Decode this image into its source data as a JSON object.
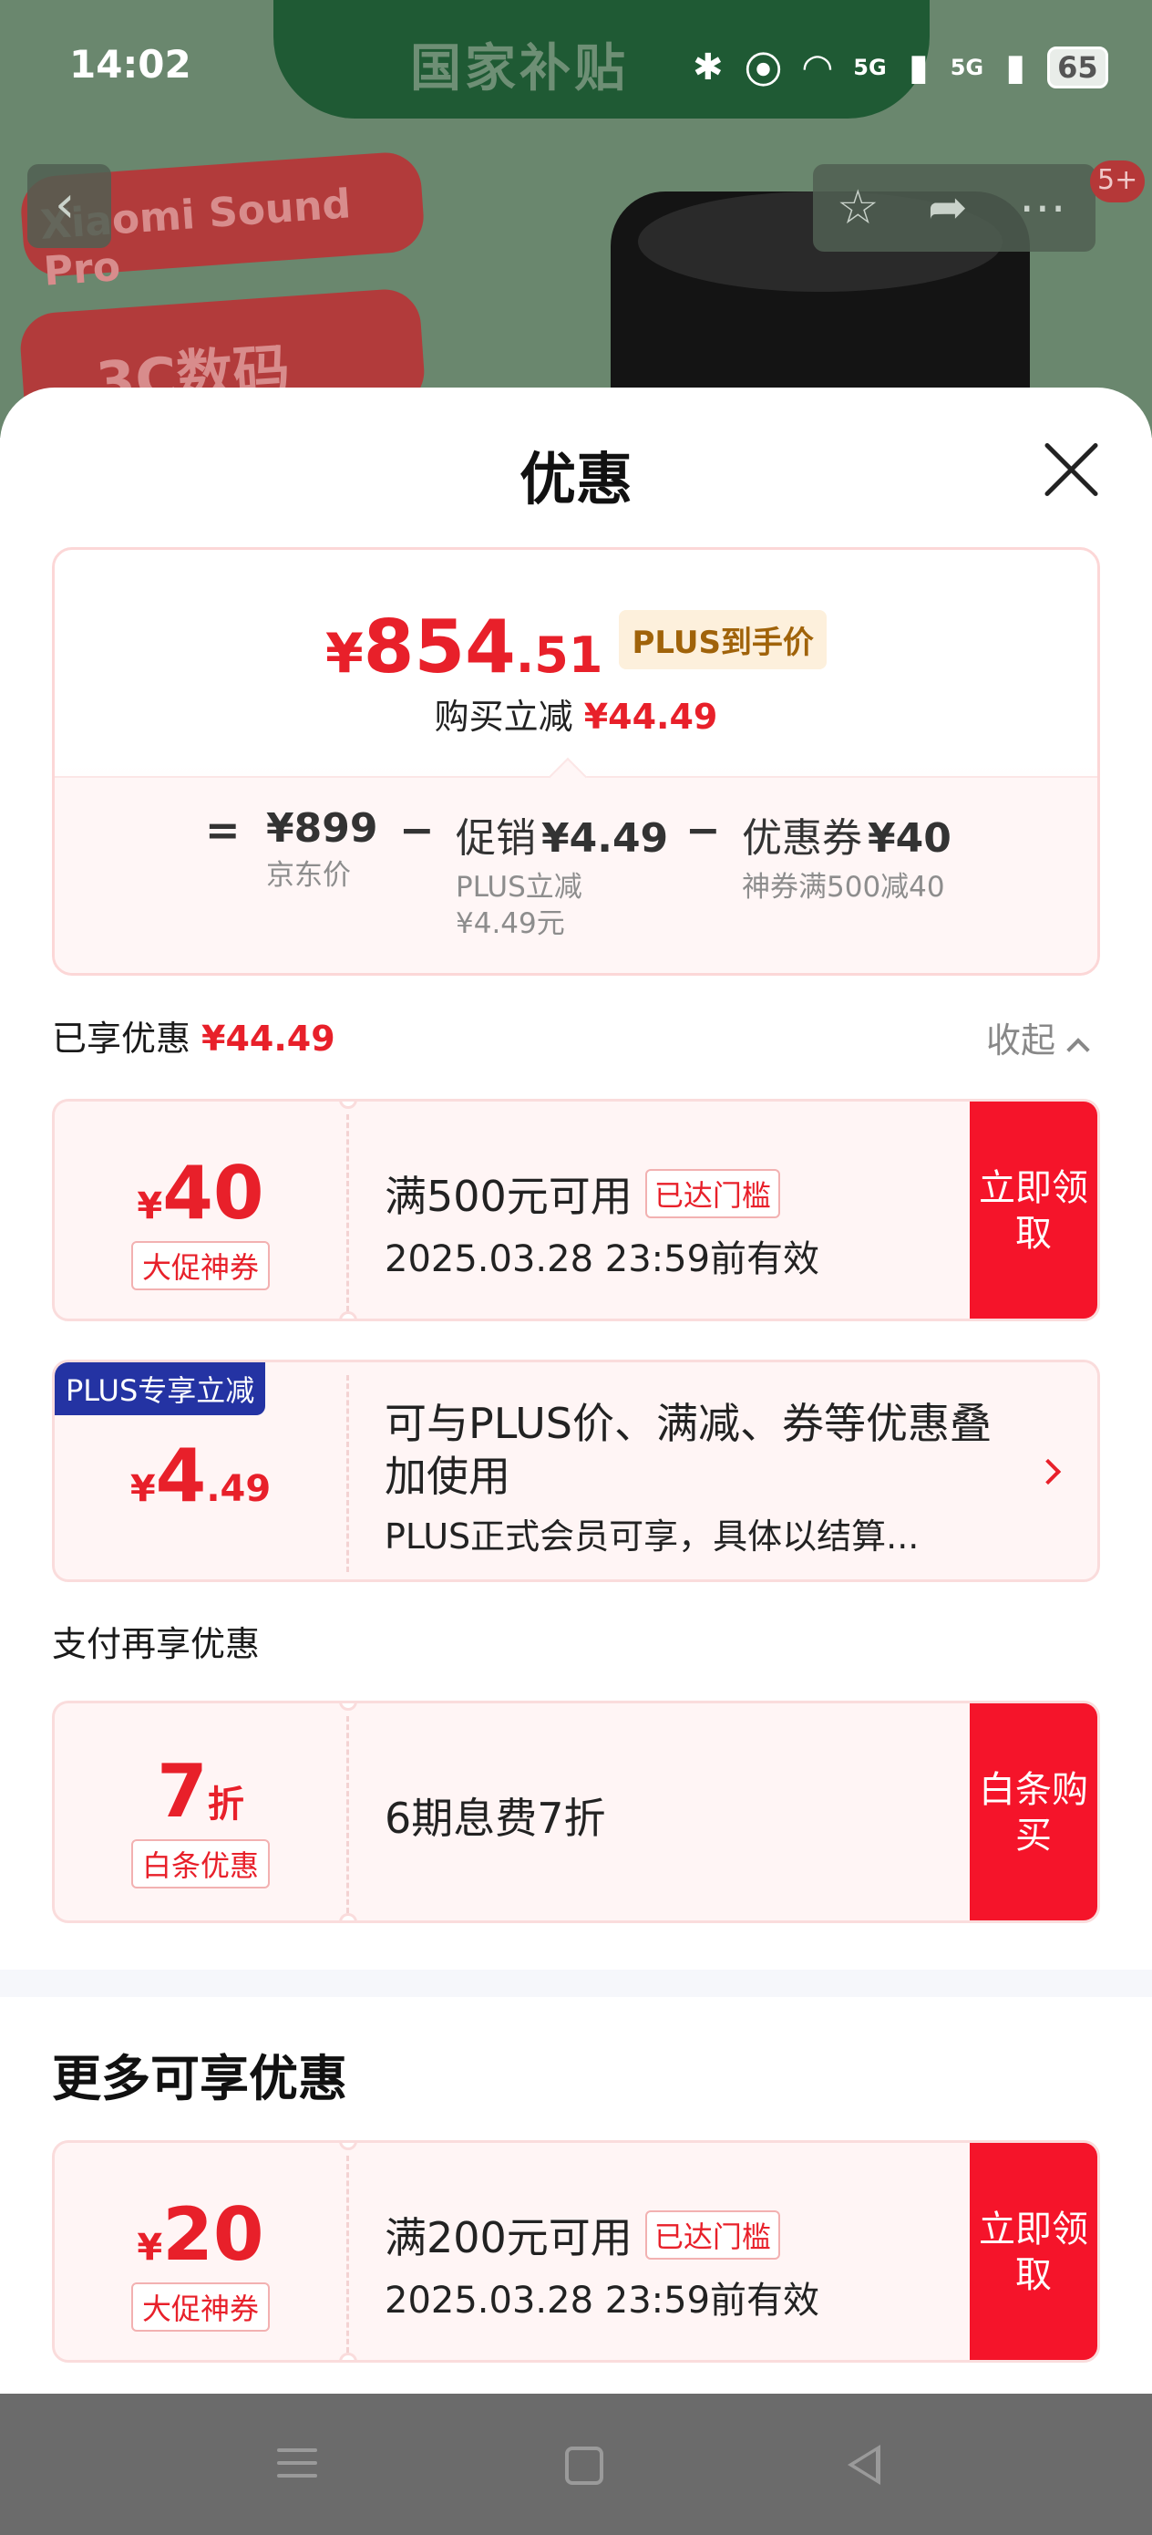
{
  "status_bar": {
    "time": "14:02",
    "signal1": "5G",
    "signal2": "5G",
    "battery": "65"
  },
  "background": {
    "banner_text": "国家补贴",
    "pill1": "Xiaomi Sound Pro",
    "pill2": "3C数码",
    "badge": "5+"
  },
  "sheet": {
    "title": "优惠",
    "price": {
      "currency": "¥",
      "integer": "854",
      "decimal": ".51",
      "tag": "PLUS到手价",
      "reduce_label": "购买立减",
      "reduce_value": "¥44.49"
    },
    "breakdown": {
      "equals": "=",
      "minus": "−",
      "jd_price": "¥899",
      "jd_label": "京东价",
      "promo_label": "促销",
      "promo_value": "¥4.49",
      "promo_sub1": "PLUS立减",
      "promo_sub2": "¥4.49元",
      "coupon_label": "优惠券",
      "coupon_value": "¥40",
      "coupon_sub": "神券满500减40"
    },
    "enjoyed": {
      "label": "已享优惠",
      "value": "¥44.49",
      "collapse": "收起"
    },
    "coupon1": {
      "currency": "¥",
      "amount": "40",
      "tag": "大促神券",
      "condition": "满500元可用",
      "reached": "已达门槛",
      "expiry": "2025.03.28 23:59前有效",
      "button": "立即领取"
    },
    "plus": {
      "badge": "PLUS专享立减",
      "currency": "¥",
      "amount": "4",
      "decimal": ".49",
      "line1": "可与PLUS价、满减、券等优惠叠加使用",
      "line2": "PLUS正式会员可享，具体以结算..."
    },
    "pay_section": {
      "label": "支付再享优惠"
    },
    "baitiao": {
      "amount": "7",
      "unit": "折",
      "tag": "白条优惠",
      "desc": "6期息费7折",
      "button": "白条购买"
    },
    "more": {
      "title": "更多可享优惠"
    },
    "coupon2": {
      "currency": "¥",
      "amount": "20",
      "tag": "大促神券",
      "condition": "满200元可用",
      "reached": "已达门槛",
      "expiry": "2025.03.28 23:59前有效",
      "button": "立即领取"
    }
  },
  "colors": {
    "accent_red": "#e8202a",
    "button_red": "#f5142a",
    "plus_blue": "#2433a3",
    "plus_gold": "#a0630a"
  },
  "icons": [
    "back-icon",
    "star-icon",
    "share-icon",
    "more-icon",
    "close-icon",
    "chevron-up-icon",
    "chevron-right-icon",
    "menu-icon",
    "home-icon",
    "back-nav-icon"
  ]
}
